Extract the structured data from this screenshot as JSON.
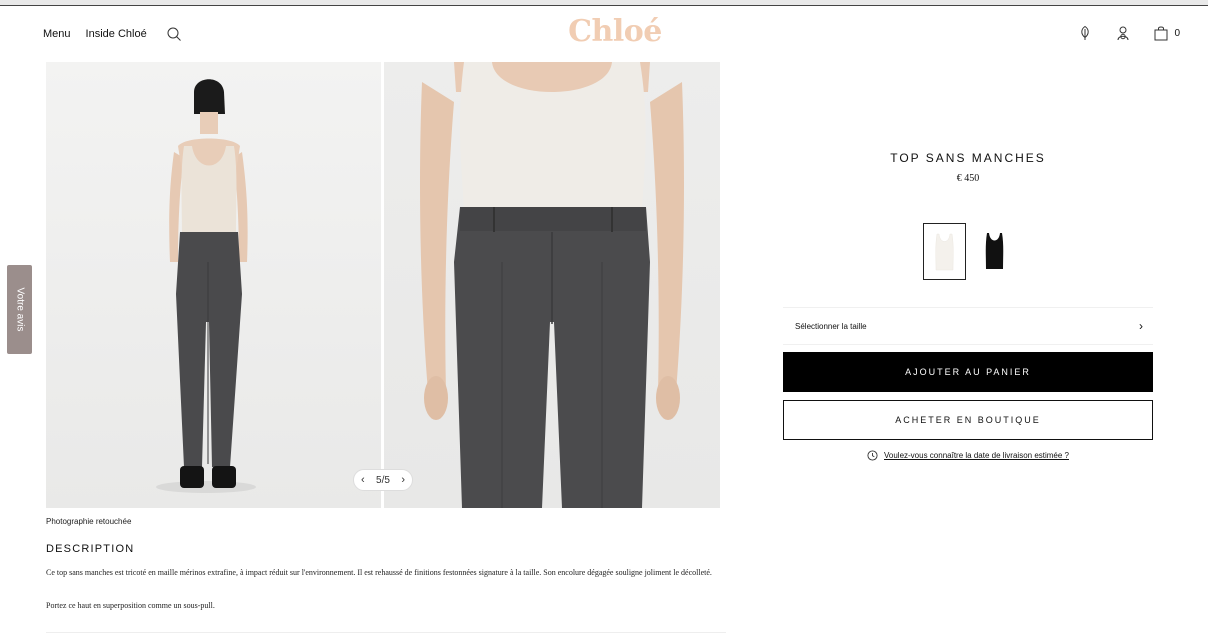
{
  "header": {
    "nav": [
      "Menu",
      "Inside Chloé"
    ],
    "logo": "Chloé",
    "cart_count": "0",
    "icons": [
      "search-icon",
      "leaf-icon",
      "account-icon",
      "bag-icon"
    ]
  },
  "feedback_tab": "Votre avis",
  "gallery": {
    "pager": {
      "current": "5/5",
      "prev": "‹",
      "next": "›"
    }
  },
  "photo_note": "Photographie retouchée",
  "description": {
    "title": "DESCRIPTION",
    "paragraphs": [
      "Ce top sans manches est tricoté en maille mérinos extrafine, à impact réduit sur l'environnement. Il est rehaussé de finitions festonnées signature à la taille. Son encolure dégagée souligne joliment le décolleté.",
      "Portez ce haut en superposition comme un sous-pull."
    ]
  },
  "product": {
    "name": "TOP SANS MANCHES",
    "price": "€ 450",
    "swatches": [
      {
        "color": "#f4f1ec",
        "selected": true
      },
      {
        "color": "#111111",
        "selected": false
      }
    ],
    "size_label": "Sélectionner la taille",
    "size_chevron": "›",
    "add_to_cart": "AJOUTER AU PANIER",
    "buy_in_store": "ACHETER EN BOUTIQUE",
    "delivery_link": "Voulez-vous connaître la date de livraison estimée ?"
  },
  "colors": {
    "logo": "#f1cdb3",
    "feedback_tab": "#9b8e8c",
    "cart_button": "#000000"
  }
}
